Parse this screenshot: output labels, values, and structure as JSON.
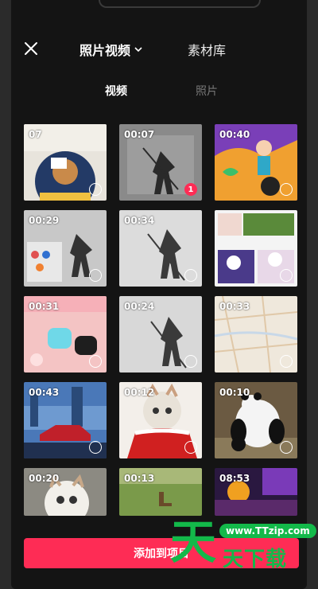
{
  "header": {
    "tab_main": "照片视频",
    "tab_library": "素材库"
  },
  "subtabs": {
    "video": "视频",
    "photo": "照片"
  },
  "media": [
    {
      "duration": "07",
      "selected": ""
    },
    {
      "duration": "00:07",
      "selected": "1"
    },
    {
      "duration": "00:40",
      "selected": ""
    },
    {
      "duration": "00:29",
      "selected": ""
    },
    {
      "duration": "00:34",
      "selected": ""
    },
    {
      "duration": "",
      "selected": ""
    },
    {
      "duration": "00:31",
      "selected": ""
    },
    {
      "duration": "00:24",
      "selected": ""
    },
    {
      "duration": "00:33",
      "selected": ""
    },
    {
      "duration": "00:43",
      "selected": ""
    },
    {
      "duration": "00:12",
      "selected": ""
    },
    {
      "duration": "00:10",
      "selected": ""
    },
    {
      "duration": "00:20",
      "selected": ""
    },
    {
      "duration": "00:13",
      "selected": ""
    },
    {
      "duration": "08:53",
      "selected": ""
    }
  ],
  "footer": {
    "add_button": "添加到项目"
  },
  "watermark": {
    "logo": "天",
    "url": "www.TTzip.com",
    "text": "天下载"
  },
  "colors": {
    "accent": "#fe2c55",
    "background": "#141414",
    "watermark": "#13b94a"
  }
}
